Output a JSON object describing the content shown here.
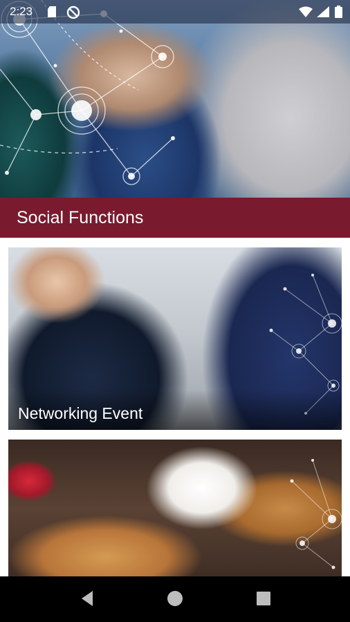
{
  "status_bar": {
    "time": "2:23",
    "icons": [
      "sd-card-icon",
      "do-not-disturb-icon",
      "wifi-icon",
      "cell-signal-icon",
      "battery-icon"
    ]
  },
  "hero": {
    "image": "business-people-meeting-photo"
  },
  "section": {
    "title": "Social Functions",
    "color": "#7a1a2e"
  },
  "cards": [
    {
      "title": "Networking Event",
      "image": "business-handshake-photo"
    },
    {
      "title": "",
      "image": "coffee-croissant-breakfast-photo"
    }
  ],
  "nav_bar": {
    "buttons": [
      "back-icon",
      "home-icon",
      "recents-icon"
    ]
  }
}
